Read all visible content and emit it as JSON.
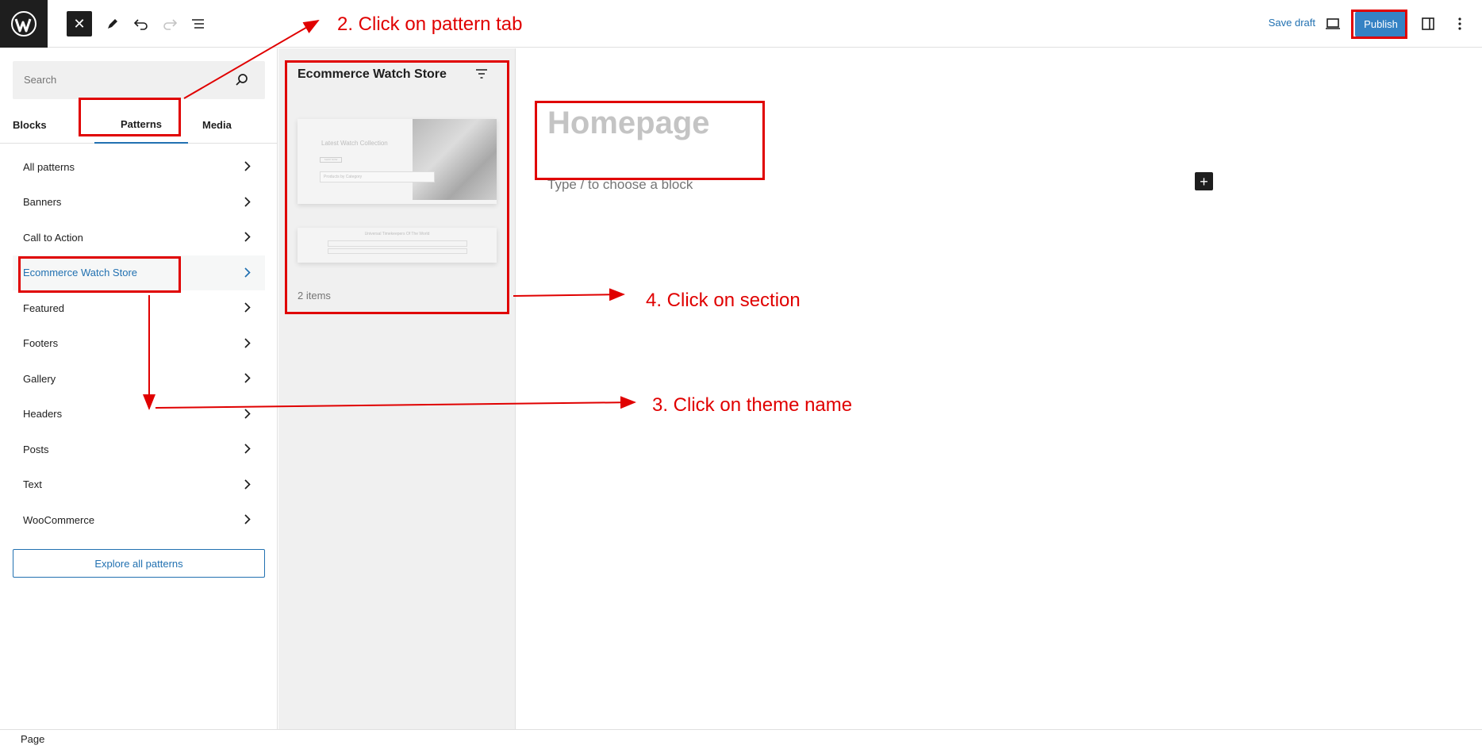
{
  "header": {
    "save_draft_label": "Save draft",
    "publish_label": "Publish"
  },
  "sidebar": {
    "search_placeholder": "Search",
    "tabs": [
      {
        "label": "Blocks"
      },
      {
        "label": "Patterns"
      },
      {
        "label": "Media"
      }
    ],
    "categories": [
      {
        "label": "All patterns"
      },
      {
        "label": "Banners"
      },
      {
        "label": "Call to Action"
      },
      {
        "label": "Ecommerce Watch Store",
        "active": true
      },
      {
        "label": "Featured"
      },
      {
        "label": "Footers"
      },
      {
        "label": "Gallery"
      },
      {
        "label": "Headers"
      },
      {
        "label": "Posts"
      },
      {
        "label": "Text"
      },
      {
        "label": "WooCommerce"
      }
    ],
    "explore_label": "Explore all patterns"
  },
  "patterns_panel": {
    "title": "Ecommerce Watch Store",
    "count_label": "2 items",
    "preview1_heading": "Latest Watch Collection",
    "preview1_button": "SHOP NOW",
    "preview1_category": "Products by Category",
    "preview2_heading": "Universal Timekeepers Of The World"
  },
  "editor": {
    "title_placeholder": "Homepage",
    "block_placeholder": "Type / to choose a block"
  },
  "footer": {
    "label": "Page"
  },
  "annotations": {
    "step2": "2. Click on pattern tab",
    "step3": "3. Click on theme name",
    "step4": "4. Click on section",
    "color": "#e00000"
  },
  "colors": {
    "accent": "#2271b1",
    "publish": "#3582c4",
    "dark": "#1e1e1e"
  }
}
